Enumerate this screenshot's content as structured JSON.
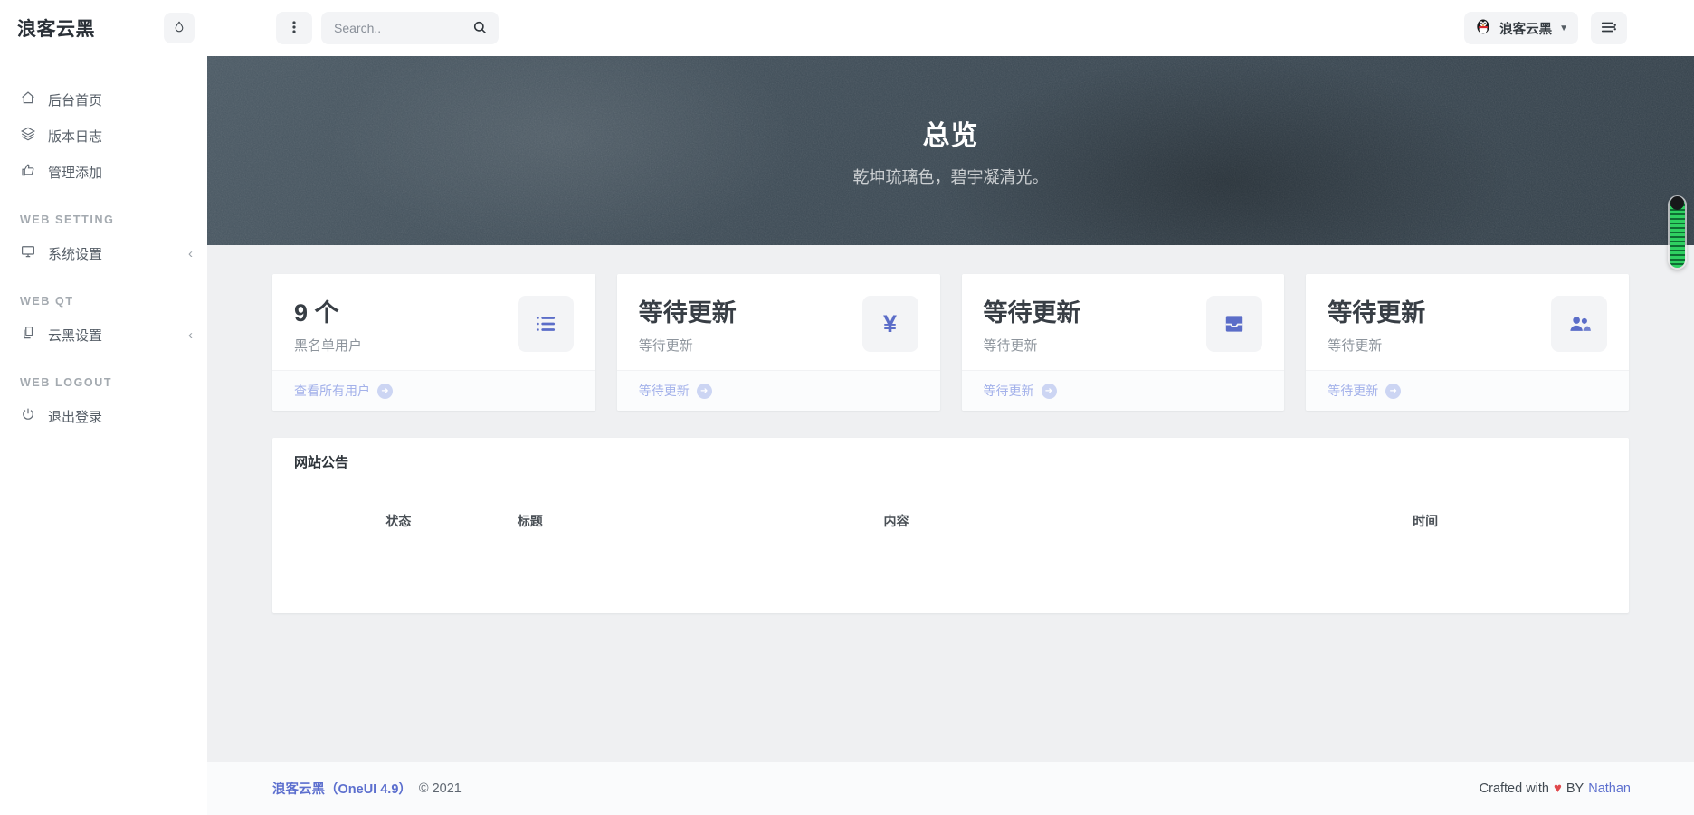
{
  "brand": {
    "logo": "浪客云黑"
  },
  "sidebar": {
    "home": "后台首页",
    "changelog": "版本日志",
    "admin_add": "管理添加",
    "section_web_setting": "WEB SETTING",
    "system_settings": "系统设置",
    "section_web_qt": "WEB QT",
    "cloud_settings": "云黑设置",
    "section_web_logout": "WEB LOGOUT",
    "logout": "退出登录"
  },
  "header": {
    "search_placeholder": "Search..",
    "user_name": "浪客云黑"
  },
  "hero": {
    "title": "总览",
    "subtitle": "乾坤琉璃色，碧宇凝清光。"
  },
  "cards": [
    {
      "value": "9 个",
      "label": "黑名单用户",
      "link": "查看所有用户",
      "icon": "list-icon"
    },
    {
      "value": "等待更新",
      "label": "等待更新",
      "link": "等待更新",
      "icon": "yen-icon"
    },
    {
      "value": "等待更新",
      "label": "等待更新",
      "link": "等待更新",
      "icon": "inbox-icon"
    },
    {
      "value": "等待更新",
      "label": "等待更新",
      "link": "等待更新",
      "icon": "users-icon"
    }
  ],
  "announcements": {
    "title": "网站公告",
    "columns": [
      "状态",
      "标题",
      "内容",
      "时间"
    ]
  },
  "footer": {
    "brand_link": "浪客云黑（OneUI 4.9）",
    "copyright": "© 2021",
    "crafted_prefix": "Crafted with",
    "heart": "♥",
    "by": "BY",
    "author": "Nathan"
  },
  "colors": {
    "accent_icon_blue": "#5b6dc8",
    "soft_link_blue": "#a3b1ea",
    "footer_link_blue": "#5c6fce",
    "heart_red": "#e0484c",
    "hero_base": "#3c4a55",
    "content_bg": "#eff0f2"
  }
}
